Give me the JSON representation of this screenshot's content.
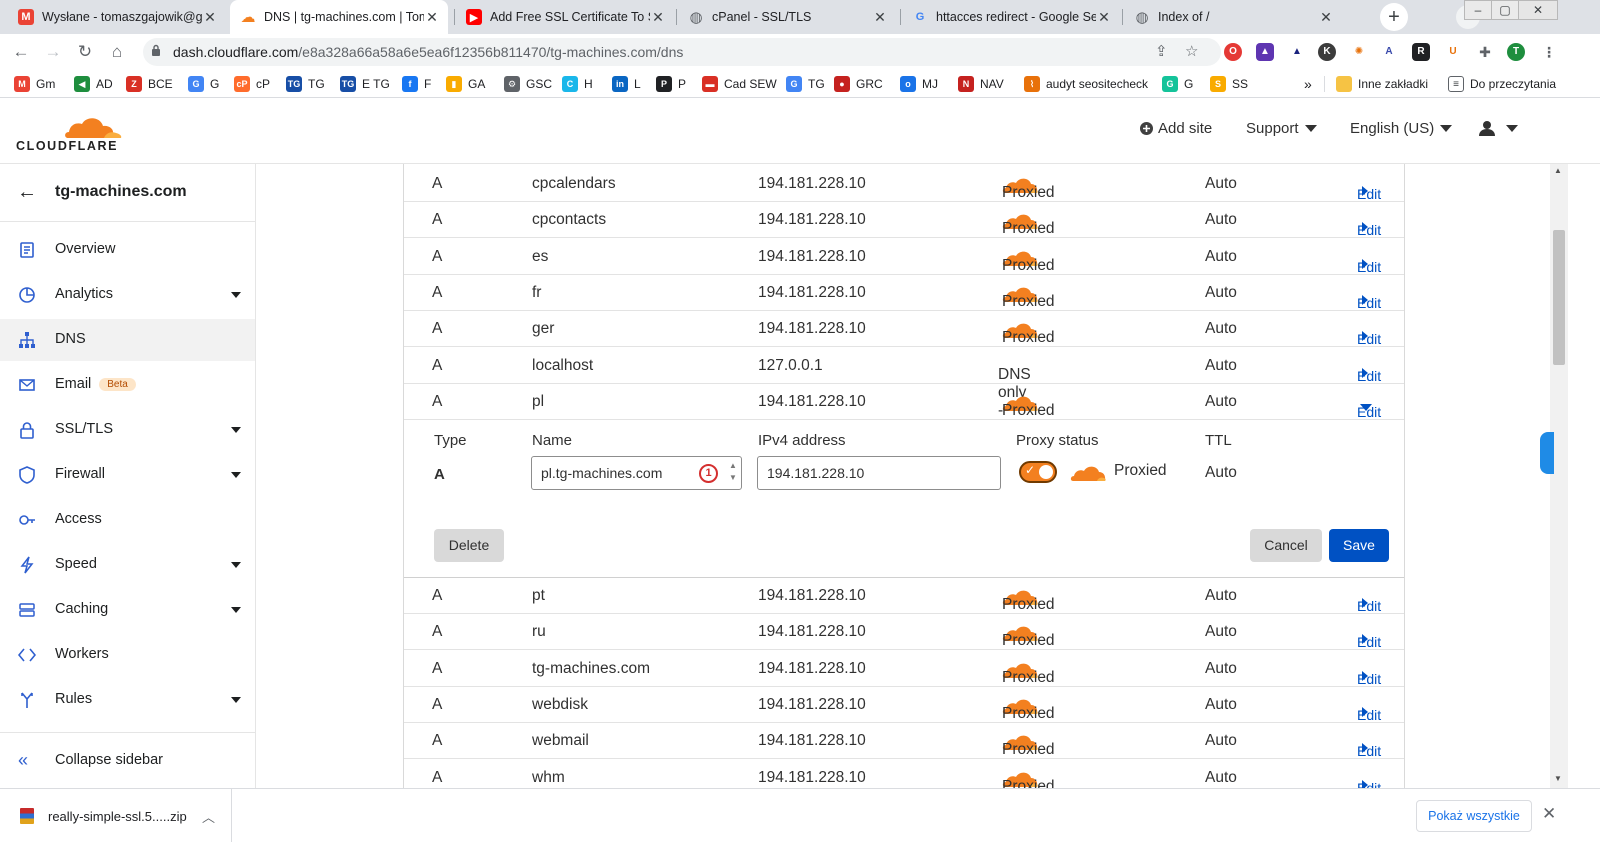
{
  "browser": {
    "tabs": [
      {
        "title": "Wysłane - tomaszgajowik@gm",
        "fav": "M",
        "color": "#ea4335"
      },
      {
        "title": "DNS | tg-machines.com | Toma",
        "fav": "☁",
        "color": "#f38020"
      },
      {
        "title": "Add Free SSL Certificate To Sub",
        "fav": "▶",
        "color": "#ff0000"
      },
      {
        "title": "cPanel - SSL/TLS",
        "fav": "◍",
        "color": "#5f6368"
      },
      {
        "title": "httacces redirect - Google Sear",
        "fav": "G",
        "color": "#4285f4"
      },
      {
        "title": "Index of /",
        "fav": "◍",
        "color": "#5f6368"
      }
    ],
    "url_host": "dash.cloudflare.com",
    "url_path": "/e8a328a66a58a6e5ea6f12356b811470/tg-machines.com/dns",
    "profile_initial": "T",
    "bookmarks": [
      {
        "label": "Gm",
        "color": "#ea4335",
        "glyph": "M"
      },
      {
        "label": "AD",
        "color": "#1e8e3e",
        "glyph": "◀"
      },
      {
        "label": "BCE",
        "color": "#d93025",
        "glyph": "Z"
      },
      {
        "label": "G",
        "color": "#4285f4",
        "glyph": "G"
      },
      {
        "label": "cP",
        "color": "#ff6c2c",
        "glyph": "cP"
      },
      {
        "label": "TG",
        "color": "#174ea6",
        "glyph": "TG"
      },
      {
        "label": "E TG",
        "color": "#174ea6",
        "glyph": "TG"
      },
      {
        "label": "F",
        "color": "#1877f2",
        "glyph": "f"
      },
      {
        "label": "GA",
        "color": "#f9ab00",
        "glyph": "▮"
      },
      {
        "label": "GSC",
        "color": "#5f6368",
        "glyph": "⚙"
      },
      {
        "label": "H",
        "color": "#1ab7ea",
        "glyph": "C"
      },
      {
        "label": "L",
        "color": "#0a66c2",
        "glyph": "in"
      },
      {
        "label": "P",
        "color": "#202124",
        "glyph": "P"
      },
      {
        "label": "Cad SEW",
        "color": "#d93025",
        "glyph": "▬"
      },
      {
        "label": "TG",
        "color": "#4285f4",
        "glyph": "G"
      },
      {
        "label": "GRC",
        "color": "#c5221f",
        "glyph": "●"
      },
      {
        "label": "MJ",
        "color": "#1a73e8",
        "glyph": "o"
      },
      {
        "label": "NAV",
        "color": "#c5221f",
        "glyph": "N"
      },
      {
        "label": "audyt seositecheck",
        "color": "#e8710a",
        "glyph": "⌇"
      },
      {
        "label": "G",
        "color": "#15c39a",
        "glyph": "G"
      },
      {
        "label": "SS",
        "color": "#f9ab00",
        "glyph": "S"
      }
    ],
    "bookmarks_more": "»",
    "other_bookmarks": "Inne zakładki",
    "reading_list": "Do przeczytania"
  },
  "header": {
    "logo_text": "CLOUDFLARE",
    "add_site": "Add site",
    "support": "Support",
    "language": "English (US)"
  },
  "sidebar": {
    "site_name": "tg-machines.com",
    "items": [
      {
        "label": "Overview",
        "icon": "overview-icon",
        "caret": false
      },
      {
        "label": "Analytics",
        "icon": "analytics-icon",
        "caret": true
      },
      {
        "label": "DNS",
        "icon": "dns-icon",
        "caret": false,
        "active": true
      },
      {
        "label": "Email",
        "icon": "email-icon",
        "caret": false,
        "badge": "Beta"
      },
      {
        "label": "SSL/TLS",
        "icon": "lock-icon",
        "caret": true
      },
      {
        "label": "Firewall",
        "icon": "shield-icon",
        "caret": true
      },
      {
        "label": "Access",
        "icon": "access-icon",
        "caret": false
      },
      {
        "label": "Speed",
        "icon": "bolt-icon",
        "caret": true
      },
      {
        "label": "Caching",
        "icon": "caching-icon",
        "caret": true
      },
      {
        "label": "Workers",
        "icon": "workers-icon",
        "caret": false
      },
      {
        "label": "Rules",
        "icon": "rules-icon",
        "caret": true
      }
    ],
    "collapse_label": "Collapse sidebar"
  },
  "dns": {
    "rows_before": [
      {
        "type": "A",
        "name": "cpcalendars",
        "content": "194.181.228.10",
        "proxy": "Proxied",
        "proxied": true,
        "ttl": "Auto",
        "edit": "Edit"
      },
      {
        "type": "A",
        "name": "cpcontacts",
        "content": "194.181.228.10",
        "proxy": "Proxied",
        "proxied": true,
        "ttl": "Auto",
        "edit": "Edit"
      },
      {
        "type": "A",
        "name": "es",
        "content": "194.181.228.10",
        "proxy": "Proxied",
        "proxied": true,
        "ttl": "Auto",
        "edit": "Edit"
      },
      {
        "type": "A",
        "name": "fr",
        "content": "194.181.228.10",
        "proxy": "Proxied",
        "proxied": true,
        "ttl": "Auto",
        "edit": "Edit"
      },
      {
        "type": "A",
        "name": "ger",
        "content": "194.181.228.10",
        "proxy": "Proxied",
        "proxied": true,
        "ttl": "Auto",
        "edit": "Edit"
      },
      {
        "type": "A",
        "name": "localhost",
        "content": "127.0.0.1",
        "proxy": "DNS only - local IP",
        "proxied": false,
        "ttl": "Auto",
        "edit": "Edit"
      },
      {
        "type": "A",
        "name": "pl",
        "content": "194.181.228.10",
        "proxy": "Proxied",
        "proxied": true,
        "ttl": "Auto",
        "edit": "Edit",
        "expanded": true
      }
    ],
    "editor": {
      "type_label": "Type",
      "name_label": "Name",
      "address_label": "IPv4 address",
      "proxy_label": "Proxy status",
      "ttl_label": "TTL",
      "type_value": "A",
      "name_value": "pl.tg-machines.com",
      "address_value": "194.181.228.10",
      "proxy_value": "Proxied",
      "ttl_value": "Auto",
      "badge": "1",
      "delete": "Delete",
      "cancel": "Cancel",
      "save": "Save"
    },
    "rows_after": [
      {
        "type": "A",
        "name": "pt",
        "content": "194.181.228.10",
        "proxy": "Proxied",
        "proxied": true,
        "ttl": "Auto",
        "edit": "Edit"
      },
      {
        "type": "A",
        "name": "ru",
        "content": "194.181.228.10",
        "proxy": "Proxied",
        "proxied": true,
        "ttl": "Auto",
        "edit": "Edit"
      },
      {
        "type": "A",
        "name": "tg-machines.com",
        "content": "194.181.228.10",
        "proxy": "Proxied",
        "proxied": true,
        "ttl": "Auto",
        "edit": "Edit"
      },
      {
        "type": "A",
        "name": "webdisk",
        "content": "194.181.228.10",
        "proxy": "Proxied",
        "proxied": true,
        "ttl": "Auto",
        "edit": "Edit"
      },
      {
        "type": "A",
        "name": "webmail",
        "content": "194.181.228.10",
        "proxy": "Proxied",
        "proxied": true,
        "ttl": "Auto",
        "edit": "Edit"
      },
      {
        "type": "A",
        "name": "whm",
        "content": "194.181.228.10",
        "proxy": "Proxied",
        "proxied": true,
        "ttl": "Auto",
        "edit": "Edit"
      }
    ]
  },
  "downloads": {
    "file": "really-simple-ssl.5.....zip",
    "show_all": "Pokaż wszystkie"
  },
  "colors": {
    "accent": "#0051c3",
    "cloud": "#f38020"
  }
}
